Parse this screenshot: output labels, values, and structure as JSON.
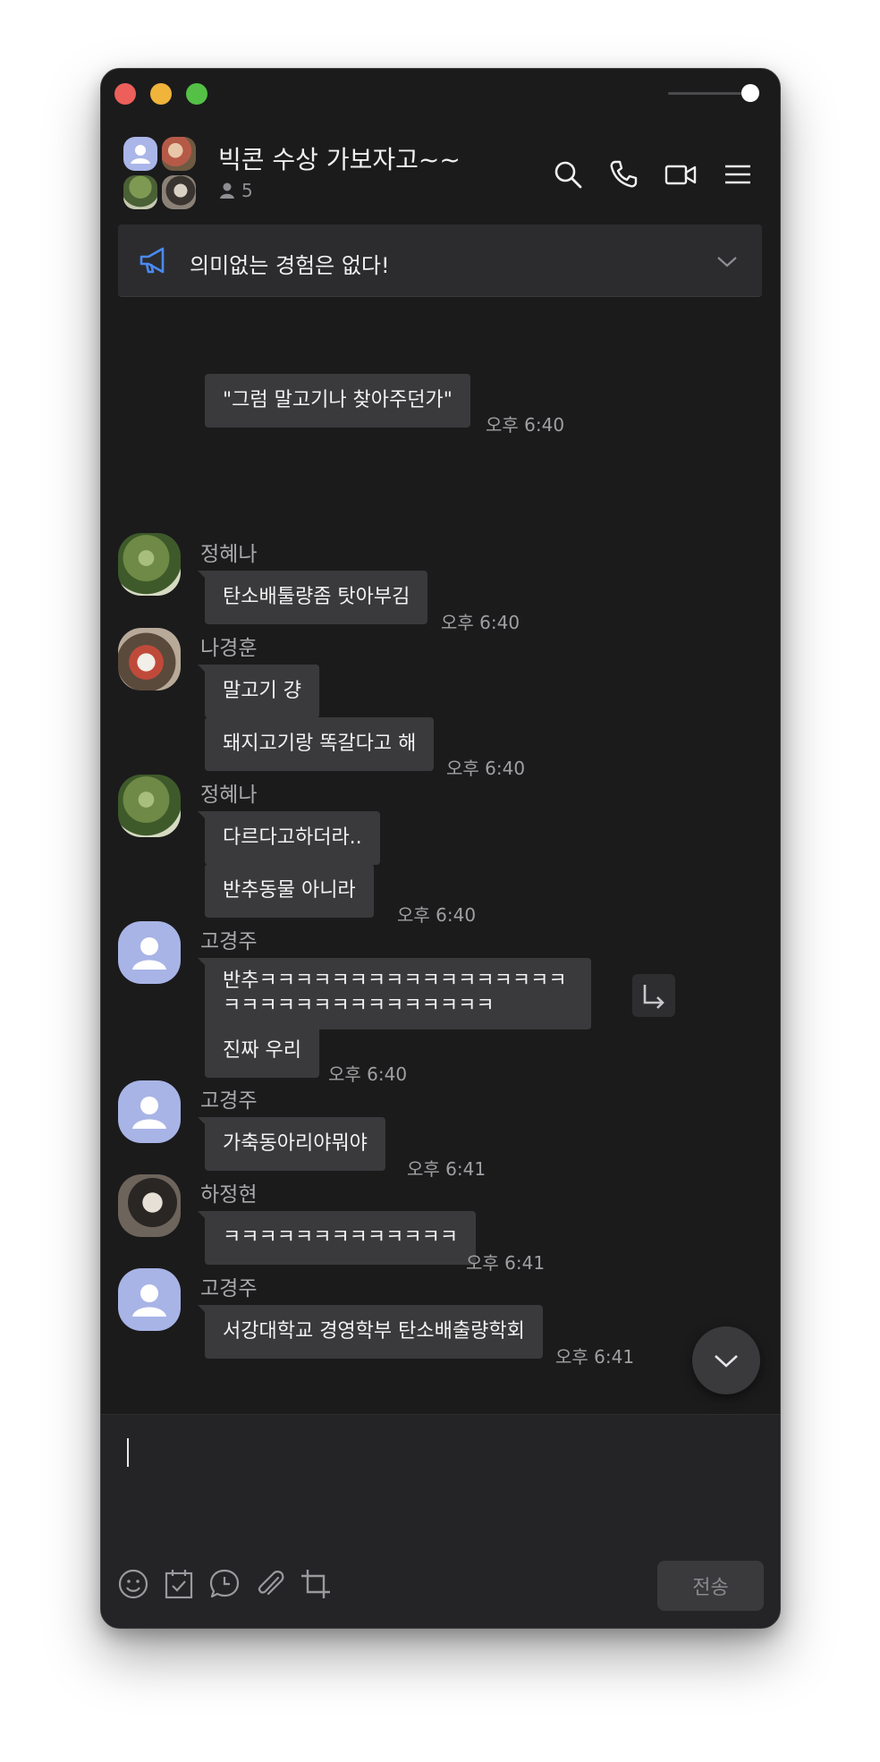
{
  "window": {
    "accent_color": "#aab6e8"
  },
  "header": {
    "title": "빅콘 수상 가보자고~~",
    "member_count": "5",
    "icons": [
      "search-icon",
      "phone-icon",
      "video-icon",
      "menu-icon"
    ]
  },
  "notice": {
    "text": "의미없는 경험은 없다!"
  },
  "messages": [
    {
      "sender": "",
      "bubbles": [
        "\"그럼 말고기나 찾아주던가\""
      ],
      "time": "오후 6:40"
    },
    {
      "sender": "정혜나",
      "bubbles": [
        "탄소배툴량좀 탓아부김"
      ],
      "time": "오후 6:40"
    },
    {
      "sender": "나경훈",
      "bubbles": [
        "말고기 걍",
        "돼지고기랑 똑갈다고 해"
      ],
      "time": "오후 6:40"
    },
    {
      "sender": "정혜나",
      "bubbles": [
        "다르다고하더라..",
        "반추동물 아니라"
      ],
      "time": "오후 6:40"
    },
    {
      "sender": "고경주",
      "bubbles": [
        "반추ㅋㅋㅋㅋㅋㅋㅋㅋㅋㅋㅋㅋㅋㅋㅋㅋㅋㅋㅋㅋㅋㅋㅋㅋㅋㅋㅋㅋㅋㅋㅋㅋ",
        "진짜 우리"
      ],
      "time": "오후 6:40"
    },
    {
      "sender": "고경주",
      "bubbles": [
        "가축동아리야뭐야"
      ],
      "time": "오후 6:41"
    },
    {
      "sender": "하정현",
      "bubbles": [
        "ㅋㅋㅋㅋㅋㅋㅋㅋㅋㅋㅋㅋㅋ"
      ],
      "time": "오후 6:41"
    },
    {
      "sender": "고경주",
      "bubbles": [
        "서강대학교 경영학부 탄소배출량학회"
      ],
      "time": "오후 6:41"
    }
  ],
  "composer": {
    "tools": [
      "emoji-icon",
      "calendar-icon",
      "schedule-message-icon",
      "attach-icon",
      "crop-icon"
    ],
    "send_label": "전송"
  }
}
